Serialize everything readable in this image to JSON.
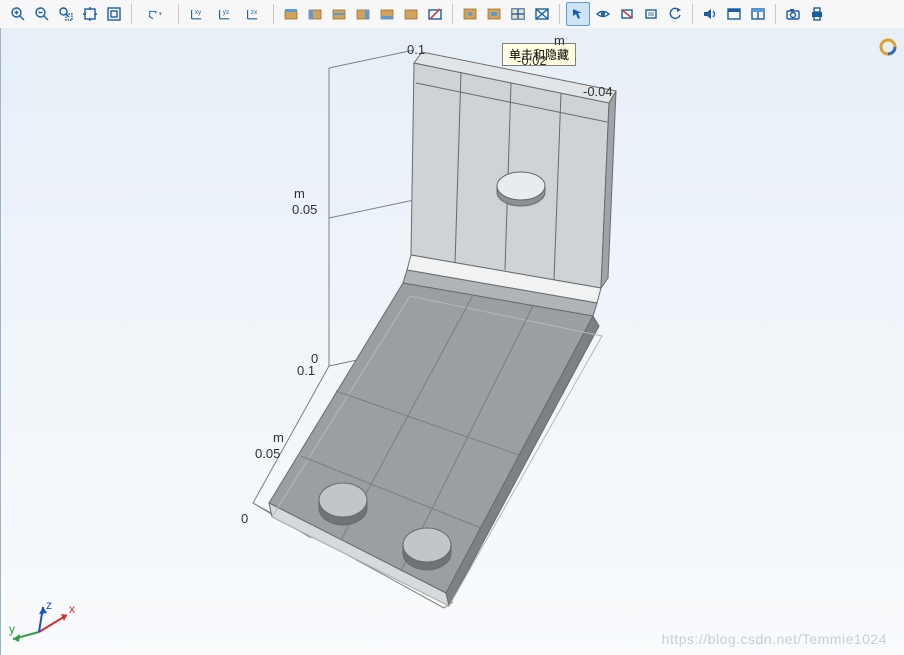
{
  "toolbar": {
    "groups": [
      [
        "zoom-in",
        "zoom-out",
        "zoom-box",
        "zoom-extents",
        "zoom-selected"
      ],
      [
        "orbit-dropdown"
      ],
      [
        "plane-xy",
        "plane-yz",
        "plane-zx"
      ],
      [
        "select-box",
        "select-tan-1",
        "select-tan-2",
        "select-tan-3",
        "select-tan-4",
        "select-tan-5",
        "select-disable"
      ],
      [
        "render-1",
        "render-2",
        "render-box",
        "render-diag"
      ],
      [
        "hide-arrow",
        "hide-eye",
        "hide-box-1",
        "hide-box-2",
        "hide-undo"
      ],
      [
        "sound",
        "window-1",
        "window-2"
      ],
      [
        "camera",
        "print"
      ]
    ],
    "selected": "hide-arrow",
    "labels": {
      "zoom-in": "Zoom In",
      "zoom-out": "Zoom Out",
      "zoom-box": "Zoom Box",
      "zoom-extents": "Zoom Extents",
      "zoom-selected": "Zoom Selected",
      "orbit-dropdown": "Orbit",
      "plane-xy": "xy",
      "plane-yz": "yz",
      "plane-zx": "zx",
      "select-box": "Select",
      "select-tan-1": "Obj 1",
      "select-tan-2": "Obj 2",
      "select-tan-3": "Obj 3",
      "select-tan-4": "Obj 4",
      "select-tan-5": "Obj 5",
      "select-disable": "No Select",
      "render-1": "Render A",
      "render-2": "Render B",
      "render-box": "Wireframe",
      "render-diag": "Transparent",
      "hide-arrow": "Click and Hide",
      "hide-eye": "Show",
      "hide-box-1": "Hide Sel",
      "hide-box-2": "Hide Unsel",
      "hide-undo": "Reset Hide",
      "sound": "Sound",
      "window-1": "View 1",
      "window-2": "View 2",
      "camera": "Snapshot",
      "print": "Print"
    }
  },
  "tooltip": "单击和隐藏",
  "axis": {
    "z_unit": "m",
    "z_ticks": [
      "0.1",
      "0.05",
      "0"
    ],
    "y_unit": "m",
    "y_ticks_top": [
      "-0.02",
      "-0.04"
    ],
    "x_unit": "m",
    "x_ticks": [
      "0",
      "0.05",
      "0.1"
    ],
    "x_zero": "0"
  },
  "orient": {
    "x": "x",
    "y": "y",
    "z": "z"
  },
  "watermark": "https://blog.csdn.net/Temmie1024",
  "ring_button": "results-ring"
}
